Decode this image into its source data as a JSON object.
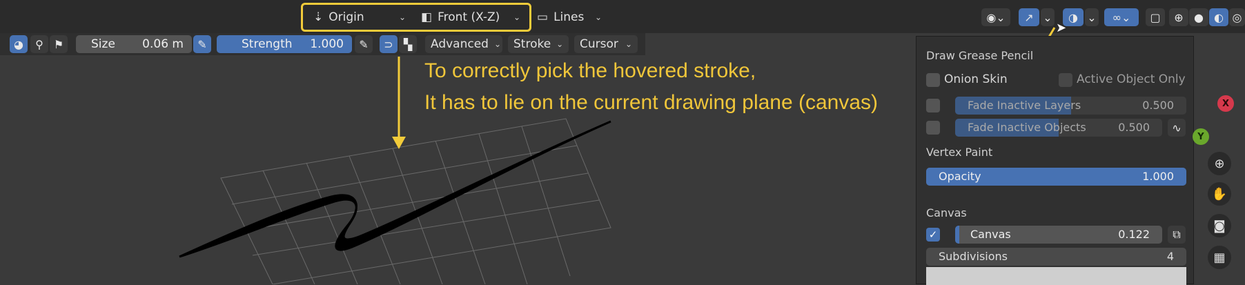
{
  "header": {
    "pivot_label": "Origin",
    "view_label": "Front (X-Z)",
    "lines_label": "Lines"
  },
  "toolbar": {
    "size_label": "Size",
    "size_value": "0.06 m",
    "strength_label": "Strength",
    "strength_value": "1.000",
    "advanced_label": "Advanced",
    "stroke_label": "Stroke",
    "cursor_label": "Cursor"
  },
  "annotation": {
    "line1": "To correctly pick the hovered stroke,",
    "line2": "It has to lie on the current drawing plane (canvas)"
  },
  "overlay_panel": {
    "title": "Draw Grease Pencil",
    "onion_skin": "Onion Skin",
    "active_object_only": "Active Object Only",
    "fade_layers": {
      "label": "Fade Inactive Layers",
      "value": "0.500",
      "fill": 0.5
    },
    "fade_objects": {
      "label": "Fade Inactive Objects",
      "value": "0.500",
      "fill": 0.5
    },
    "vertex_paint": "Vertex Paint",
    "opacity": {
      "label": "Opacity",
      "value": "1.000",
      "fill": 1.0
    },
    "canvas_section": "Canvas",
    "canvas": {
      "label": "Canvas",
      "value": "0.122",
      "fill": 0.122,
      "checked": true
    },
    "subdivisions": {
      "label": "Subdivisions",
      "value": "4"
    }
  },
  "gizmo": {
    "x": "X",
    "y": "Y"
  },
  "colors": {
    "accent": "#4772b3",
    "highlight": "#f2cb3a",
    "background": "#3a3a3a"
  },
  "icons": [
    "pivot-icon",
    "view-icon",
    "lines-icon",
    "eye-icon",
    "gizmo-icon",
    "overlay-icon",
    "grease-overlay-icon",
    "wireframe-icon",
    "solid-icon",
    "material-icon",
    "rendered-icon",
    "zoom-icon",
    "hand-icon",
    "camera-icon",
    "grid-icon"
  ]
}
